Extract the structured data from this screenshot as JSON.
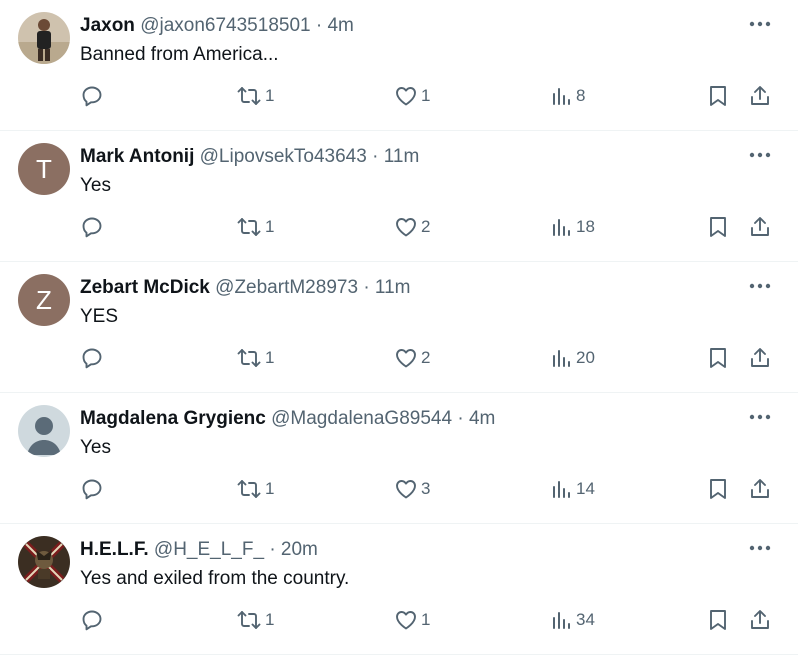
{
  "tweets": [
    {
      "name": "Jaxon",
      "handle": "@jaxon6743518501",
      "separator": "·",
      "time": "4m",
      "text": "Banned from America...",
      "retweets": "1",
      "likes": "1",
      "views": "8",
      "avatar": {
        "type": "photo-person"
      }
    },
    {
      "name": "Mark Antonij",
      "handle": "@LipovsekTo43643",
      "separator": "·",
      "time": "11m",
      "text": "Yes",
      "retweets": "1",
      "likes": "2",
      "views": "18",
      "avatar": {
        "type": "letter",
        "letter": "T",
        "color": "#8b6f62"
      }
    },
    {
      "name": "Zebart McDick",
      "handle": "@ZebartM28973",
      "separator": "·",
      "time": "11m",
      "text": "YES",
      "retweets": "1",
      "likes": "2",
      "views": "20",
      "avatar": {
        "type": "letter",
        "letter": "Z",
        "color": "#8b6f62"
      }
    },
    {
      "name": "Magdalena Grygienc",
      "handle": "@MagdalenaG89544",
      "separator": "·",
      "time": "4m",
      "text": "Yes",
      "retweets": "1",
      "likes": "3",
      "views": "14",
      "avatar": {
        "type": "default-silhouette"
      }
    },
    {
      "name": "H.E.L.F.",
      "handle": "@H_E_L_F_",
      "separator": "·",
      "time": "20m",
      "text": "Yes and exiled from the country.",
      "retweets": "1",
      "likes": "1",
      "views": "34",
      "avatar": {
        "type": "emblem-image"
      }
    }
  ],
  "colors": {
    "text": "#0f1419",
    "secondary": "#536471",
    "border": "#eff3f4",
    "letter_avatar": "#8b6f62"
  },
  "icons": [
    "reply-icon",
    "retweet-icon",
    "like-icon",
    "views-icon",
    "bookmark-icon",
    "share-icon",
    "more-icon"
  ]
}
